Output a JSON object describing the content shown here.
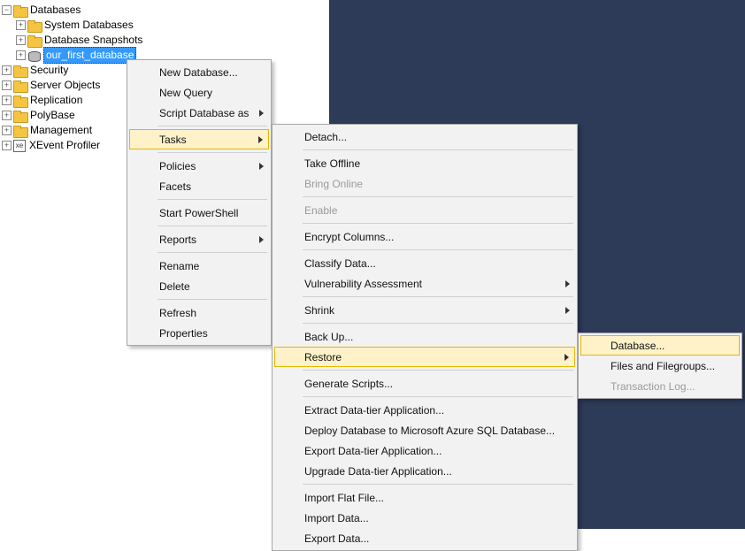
{
  "tree": {
    "root": "Databases",
    "children": [
      "System Databases",
      "Database Snapshots",
      "our_first_database"
    ],
    "siblings": [
      "Security",
      "Server Objects",
      "Replication",
      "PolyBase",
      "Management",
      "XEvent Profiler"
    ]
  },
  "menu1": {
    "new_database": "New Database...",
    "new_query": "New Query",
    "script_db_as": "Script Database as",
    "tasks": "Tasks",
    "policies": "Policies",
    "facets": "Facets",
    "start_powershell": "Start PowerShell",
    "reports": "Reports",
    "rename": "Rename",
    "delete": "Delete",
    "refresh": "Refresh",
    "properties": "Properties"
  },
  "menu2": {
    "detach": "Detach...",
    "take_offline": "Take Offline",
    "bring_online": "Bring Online",
    "enable": "Enable",
    "encrypt_columns": "Encrypt Columns...",
    "classify_data": "Classify Data...",
    "vuln_assess": "Vulnerability Assessment",
    "shrink": "Shrink",
    "back_up": "Back Up...",
    "restore": "Restore",
    "generate_scripts": "Generate Scripts...",
    "extract_dta": "Extract Data-tier Application...",
    "deploy_azure": "Deploy Database to Microsoft Azure SQL Database...",
    "export_dta": "Export Data-tier Application...",
    "upgrade_dta": "Upgrade Data-tier Application...",
    "import_flat": "Import Flat File...",
    "import_data": "Import Data...",
    "export_data": "Export Data..."
  },
  "menu3": {
    "database": "Database...",
    "files_fg": "Files and Filegroups...",
    "txn_log": "Transaction Log..."
  }
}
